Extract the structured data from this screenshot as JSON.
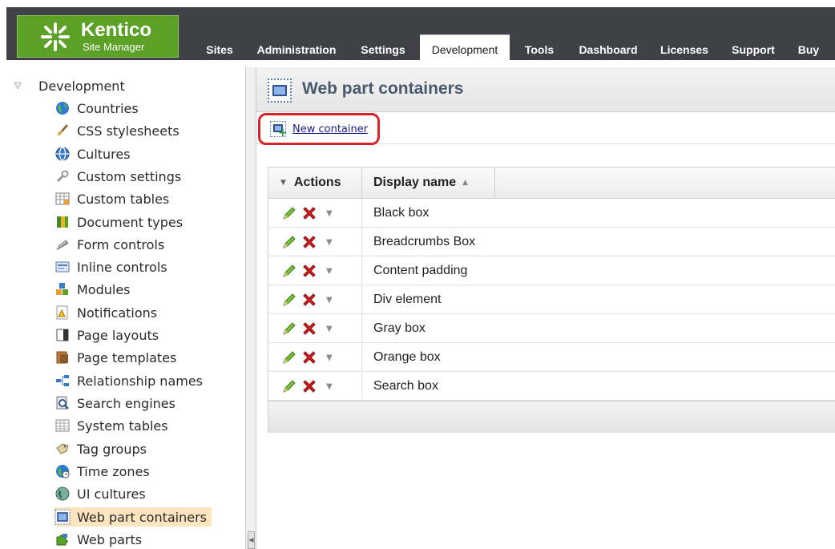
{
  "app": {
    "logo_name": "Kentico",
    "logo_subtitle": "Site Manager"
  },
  "tabs": [
    {
      "label": "Sites",
      "active": false
    },
    {
      "label": "Administration",
      "active": false
    },
    {
      "label": "Settings",
      "active": false
    },
    {
      "label": "Development",
      "active": true
    },
    {
      "label": "Tools",
      "active": false
    },
    {
      "label": "Dashboard",
      "active": false
    },
    {
      "label": "Licenses",
      "active": false
    },
    {
      "label": "Support",
      "active": false
    },
    {
      "label": "Buy",
      "active": false
    }
  ],
  "tree": {
    "root_label": "Development",
    "items": [
      {
        "label": "Countries",
        "icon": "globe-icon"
      },
      {
        "label": "CSS stylesheets",
        "icon": "brush-icon"
      },
      {
        "label": "Cultures",
        "icon": "globe-grid-icon"
      },
      {
        "label": "Custom settings",
        "icon": "wrench-icon"
      },
      {
        "label": "Custom tables",
        "icon": "table-icon"
      },
      {
        "label": "Document types",
        "icon": "book-icon"
      },
      {
        "label": "Form controls",
        "icon": "form-control-icon"
      },
      {
        "label": "Inline controls",
        "icon": "inline-control-icon"
      },
      {
        "label": "Modules",
        "icon": "modules-icon"
      },
      {
        "label": "Notifications",
        "icon": "notification-icon"
      },
      {
        "label": "Page layouts",
        "icon": "layout-icon"
      },
      {
        "label": "Page templates",
        "icon": "template-icon"
      },
      {
        "label": "Relationship names",
        "icon": "relationship-icon"
      },
      {
        "label": "Search engines",
        "icon": "search-icon"
      },
      {
        "label": "System tables",
        "icon": "system-table-icon"
      },
      {
        "label": "Tag groups",
        "icon": "tag-icon"
      },
      {
        "label": "Time zones",
        "icon": "clock-globe-icon"
      },
      {
        "label": "UI cultures",
        "icon": "ui-culture-icon"
      },
      {
        "label": "Web part containers",
        "icon": "container-icon",
        "selected": true
      },
      {
        "label": "Web parts",
        "icon": "puzzle-icon"
      }
    ]
  },
  "page": {
    "title": "Web part containers",
    "new_link": "New container"
  },
  "grid": {
    "col_actions": "Actions",
    "col_name": "Display name",
    "rows": [
      "Black box",
      "Breadcrumbs Box",
      "Content padding",
      "Div element",
      "Gray box",
      "Orange box",
      "Search box"
    ]
  },
  "colors": {
    "brand_green": "#5aa126",
    "topbar": "#3f4146",
    "selected_bg": "#fde5bf",
    "highlight_red": "#d9232b"
  }
}
